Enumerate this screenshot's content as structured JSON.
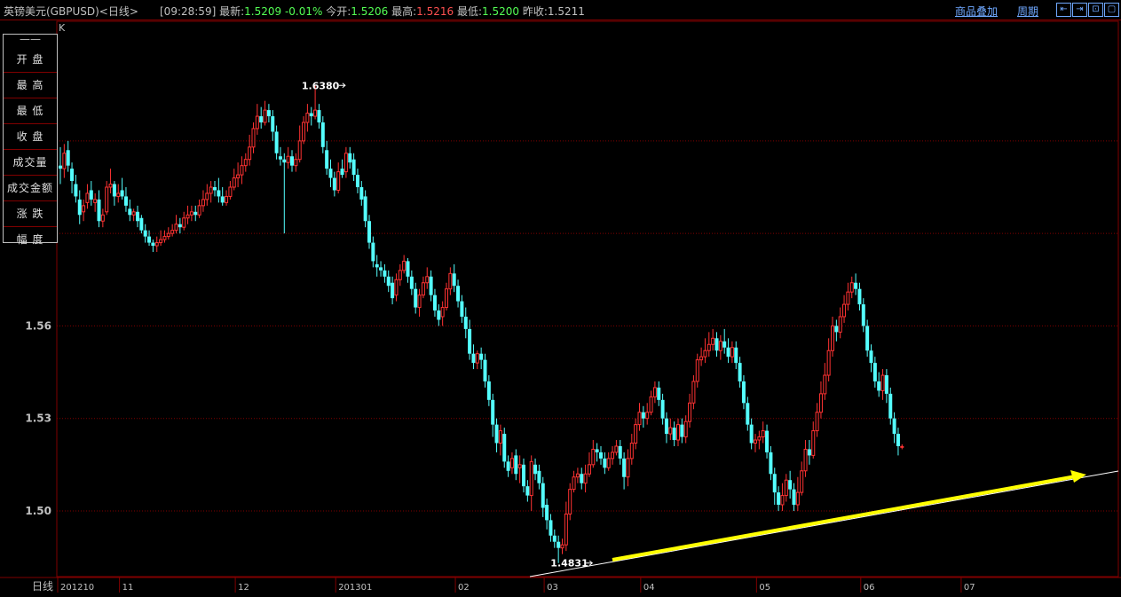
{
  "header": {
    "title": "英镑美元(GBPUSD)<日线>",
    "time": "[09:28:59]",
    "latest_label": "最新:",
    "latest_value": "1.5209",
    "change": "-0.01%",
    "open_label": "今开:",
    "open_value": "1.5206",
    "high_label": "最高:",
    "high_value": "1.5216",
    "low_label": "最低:",
    "low_value": "1.5200",
    "prev_close_label": "昨收:",
    "prev_close_value": "1.5211",
    "overlay_link": "商品叠加",
    "period_link": "周期"
  },
  "side_panel": {
    "items": [
      "开 盘",
      "最 高",
      "最 低",
      "收 盘",
      "成交量",
      "成交金额",
      "涨 跌",
      "幅 度"
    ]
  },
  "colors": {
    "up": "#ff3232",
    "down": "#54ffff",
    "grid": "#800000",
    "trend": "#ffff00"
  },
  "chart_data": {
    "type": "candlestick",
    "corner_label": "K",
    "period_label": "日线",
    "y_ticks": [
      {
        "value": 1.5,
        "label": "1.50"
      },
      {
        "value": 1.53,
        "label": "1.53"
      },
      {
        "value": 1.56,
        "label": "1.56"
      }
    ],
    "ylim": [
      1.4787,
      1.6588
    ],
    "x_ticks": [
      {
        "index": 0,
        "label": "201210"
      },
      {
        "index": 16,
        "label": "11"
      },
      {
        "index": 46,
        "label": "12"
      },
      {
        "index": 72,
        "label": "201301"
      },
      {
        "index": 103,
        "label": "02"
      },
      {
        "index": 126,
        "label": "03"
      },
      {
        "index": 151,
        "label": "04"
      },
      {
        "index": 181,
        "label": "05"
      },
      {
        "index": 208,
        "label": "06"
      },
      {
        "index": 234,
        "label": "07"
      }
    ],
    "max_annotation": {
      "index": 74,
      "value": 1.638,
      "label": "1.6380"
    },
    "min_annotation": {
      "index": 138,
      "value": 1.4831,
      "label": "1.4831"
    },
    "candles": [
      [
        1.612,
        1.611,
        1.618,
        1.606
      ],
      [
        1.611,
        1.616,
        1.619,
        1.608
      ],
      [
        1.617,
        1.612,
        1.62,
        1.61
      ],
      [
        1.611,
        1.607,
        1.613,
        1.603
      ],
      [
        1.606,
        1.602,
        1.609,
        1.6
      ],
      [
        1.601,
        1.596,
        1.604,
        1.593
      ],
      [
        1.597,
        1.599,
        1.601,
        1.594
      ],
      [
        1.6,
        1.603,
        1.606,
        1.598
      ],
      [
        1.604,
        1.601,
        1.607,
        1.599
      ],
      [
        1.6,
        1.601,
        1.603,
        1.597
      ],
      [
        1.601,
        1.594,
        1.604,
        1.592
      ],
      [
        1.594,
        1.596,
        1.598,
        1.592
      ],
      [
        1.597,
        1.605,
        1.607,
        1.596
      ],
      [
        1.605,
        1.606,
        1.611,
        1.603
      ],
      [
        1.606,
        1.602,
        1.607,
        1.599
      ],
      [
        1.602,
        1.603,
        1.606,
        1.6
      ],
      [
        1.604,
        1.602,
        1.608,
        1.601
      ],
      [
        1.602,
        1.599,
        1.605,
        1.597
      ],
      [
        1.598,
        1.596,
        1.601,
        1.594
      ],
      [
        1.596,
        1.597,
        1.598,
        1.594
      ],
      [
        1.597,
        1.594,
        1.599,
        1.592
      ],
      [
        1.595,
        1.591,
        1.596,
        1.59
      ],
      [
        1.591,
        1.589,
        1.593,
        1.587
      ],
      [
        1.589,
        1.587,
        1.591,
        1.586
      ],
      [
        1.587,
        1.586,
        1.588,
        1.584
      ],
      [
        1.586,
        1.587,
        1.589,
        1.584
      ],
      [
        1.587,
        1.588,
        1.591,
        1.586
      ],
      [
        1.588,
        1.589,
        1.591,
        1.587
      ],
      [
        1.589,
        1.59,
        1.592,
        1.588
      ],
      [
        1.59,
        1.591,
        1.593,
        1.589
      ],
      [
        1.591,
        1.593,
        1.596,
        1.59
      ],
      [
        1.593,
        1.592,
        1.595,
        1.59
      ],
      [
        1.592,
        1.595,
        1.597,
        1.591
      ],
      [
        1.595,
        1.596,
        1.599,
        1.593
      ],
      [
        1.596,
        1.597,
        1.599,
        1.594
      ],
      [
        1.597,
        1.596,
        1.599,
        1.594
      ],
      [
        1.596,
        1.599,
        1.601,
        1.595
      ],
      [
        1.599,
        1.601,
        1.604,
        1.597
      ],
      [
        1.601,
        1.603,
        1.606,
        1.599
      ],
      [
        1.603,
        1.605,
        1.607,
        1.6
      ],
      [
        1.605,
        1.604,
        1.607,
        1.602
      ],
      [
        1.604,
        1.602,
        1.608,
        1.6
      ],
      [
        1.602,
        1.6,
        1.605,
        1.599
      ],
      [
        1.6,
        1.602,
        1.604,
        1.599
      ],
      [
        1.602,
        1.605,
        1.607,
        1.601
      ],
      [
        1.605,
        1.608,
        1.611,
        1.604
      ],
      [
        1.608,
        1.609,
        1.613,
        1.605
      ],
      [
        1.609,
        1.612,
        1.615,
        1.606
      ],
      [
        1.612,
        1.614,
        1.616,
        1.61
      ],
      [
        1.614,
        1.618,
        1.622,
        1.612
      ],
      [
        1.618,
        1.624,
        1.626,
        1.616
      ],
      [
        1.624,
        1.628,
        1.632,
        1.622
      ],
      [
        1.628,
        1.626,
        1.631,
        1.624
      ],
      [
        1.626,
        1.63,
        1.633,
        1.625
      ],
      [
        1.63,
        1.628,
        1.632,
        1.626
      ],
      [
        1.628,
        1.623,
        1.63,
        1.62
      ],
      [
        1.623,
        1.616,
        1.625,
        1.614
      ],
      [
        1.615,
        1.614,
        1.618,
        1.612
      ],
      [
        1.614,
        1.613,
        1.616,
        1.59
      ],
      [
        1.613,
        1.615,
        1.618,
        1.611
      ],
      [
        1.615,
        1.612,
        1.617,
        1.61
      ],
      [
        1.612,
        1.614,
        1.616,
        1.61
      ],
      [
        1.614,
        1.62,
        1.625,
        1.613
      ],
      [
        1.62,
        1.626,
        1.628,
        1.619
      ],
      [
        1.626,
        1.629,
        1.632,
        1.623
      ],
      [
        1.629,
        1.628,
        1.631,
        1.625
      ],
      [
        1.628,
        1.63,
        1.638,
        1.627
      ],
      [
        1.63,
        1.626,
        1.632,
        1.624
      ],
      [
        1.626,
        1.618,
        1.628,
        1.616
      ],
      [
        1.617,
        1.611,
        1.62,
        1.609
      ],
      [
        1.611,
        1.608,
        1.614,
        1.605
      ],
      [
        1.608,
        1.604,
        1.61,
        1.602
      ],
      [
        1.604,
        1.61,
        1.613,
        1.603
      ],
      [
        1.611,
        1.609,
        1.614,
        1.608
      ],
      [
        1.61,
        1.616,
        1.618,
        1.608
      ],
      [
        1.616,
        1.613,
        1.618,
        1.611
      ],
      [
        1.614,
        1.609,
        1.616,
        1.607
      ],
      [
        1.609,
        1.605,
        1.611,
        1.603
      ],
      [
        1.605,
        1.601,
        1.607,
        1.599
      ],
      [
        1.602,
        1.594,
        1.604,
        1.592
      ],
      [
        1.594,
        1.587,
        1.596,
        1.585
      ],
      [
        1.587,
        1.581,
        1.589,
        1.579
      ],
      [
        1.58,
        1.579,
        1.583,
        1.576
      ],
      [
        1.579,
        1.578,
        1.581,
        1.576
      ],
      [
        1.578,
        1.576,
        1.58,
        1.574
      ],
      [
        1.576,
        1.573,
        1.578,
        1.571
      ],
      [
        1.574,
        1.569,
        1.576,
        1.567
      ],
      [
        1.57,
        1.575,
        1.577,
        1.568
      ],
      [
        1.575,
        1.578,
        1.58,
        1.573
      ],
      [
        1.578,
        1.581,
        1.583,
        1.577
      ],
      [
        1.581,
        1.576,
        1.582,
        1.574
      ],
      [
        1.576,
        1.572,
        1.578,
        1.57
      ],
      [
        1.572,
        1.566,
        1.574,
        1.564
      ],
      [
        1.566,
        1.57,
        1.572,
        1.563
      ],
      [
        1.57,
        1.574,
        1.576,
        1.569
      ],
      [
        1.574,
        1.576,
        1.579,
        1.572
      ],
      [
        1.576,
        1.57,
        1.578,
        1.568
      ],
      [
        1.57,
        1.565,
        1.572,
        1.563
      ],
      [
        1.565,
        1.562,
        1.567,
        1.56
      ],
      [
        1.563,
        1.566,
        1.568,
        1.56
      ],
      [
        1.566,
        1.572,
        1.574,
        1.565
      ],
      [
        1.572,
        1.577,
        1.579,
        1.57
      ],
      [
        1.577,
        1.573,
        1.58,
        1.571
      ],
      [
        1.573,
        1.568,
        1.575,
        1.566
      ],
      [
        1.568,
        1.563,
        1.57,
        1.561
      ],
      [
        1.563,
        1.559,
        1.566,
        1.556
      ],
      [
        1.559,
        1.551,
        1.562,
        1.549
      ],
      [
        1.551,
        1.548,
        1.554,
        1.546
      ],
      [
        1.548,
        1.551,
        1.552,
        1.546
      ],
      [
        1.551,
        1.549,
        1.553,
        1.546
      ],
      [
        1.549,
        1.542,
        1.551,
        1.54
      ],
      [
        1.542,
        1.536,
        1.544,
        1.534
      ],
      [
        1.536,
        1.528,
        1.538,
        1.524
      ],
      [
        1.528,
        1.522,
        1.53,
        1.519
      ],
      [
        1.522,
        1.526,
        1.528,
        1.518
      ],
      [
        1.525,
        1.516,
        1.527,
        1.514
      ],
      [
        1.516,
        1.513,
        1.518,
        1.511
      ],
      [
        1.514,
        1.517,
        1.519,
        1.512
      ],
      [
        1.518,
        1.512,
        1.52,
        1.51
      ],
      [
        1.514,
        1.515,
        1.518,
        1.509
      ],
      [
        1.515,
        1.508,
        1.517,
        1.506
      ],
      [
        1.508,
        1.505,
        1.51,
        1.503
      ],
      [
        1.505,
        1.516,
        1.518,
        1.5
      ],
      [
        1.515,
        1.512,
        1.517,
        1.51
      ],
      [
        1.513,
        1.509,
        1.515,
        1.507
      ],
      [
        1.509,
        1.501,
        1.511,
        1.498
      ],
      [
        1.502,
        1.497,
        1.504,
        1.494
      ],
      [
        1.497,
        1.492,
        1.499,
        1.49
      ],
      [
        1.492,
        1.49,
        1.494,
        1.488
      ],
      [
        1.49,
        1.488,
        1.492,
        1.4831
      ],
      [
        1.488,
        1.489,
        1.491,
        1.486
      ],
      [
        1.489,
        1.499,
        1.503,
        1.487
      ],
      [
        1.499,
        1.507,
        1.509,
        1.497
      ],
      [
        1.507,
        1.511,
        1.513,
        1.506
      ],
      [
        1.511,
        1.512,
        1.514,
        1.509
      ],
      [
        1.512,
        1.509,
        1.514,
        1.507
      ],
      [
        1.509,
        1.512,
        1.515,
        1.506
      ],
      [
        1.512,
        1.515,
        1.519,
        1.511
      ],
      [
        1.515,
        1.52,
        1.523,
        1.514
      ],
      [
        1.52,
        1.519,
        1.522,
        1.516
      ],
      [
        1.519,
        1.517,
        1.521,
        1.515
      ],
      [
        1.517,
        1.514,
        1.519,
        1.512
      ],
      [
        1.514,
        1.517,
        1.519,
        1.513
      ],
      [
        1.517,
        1.519,
        1.521,
        1.515
      ],
      [
        1.519,
        1.521,
        1.523,
        1.518
      ],
      [
        1.521,
        1.517,
        1.523,
        1.515
      ],
      [
        1.517,
        1.511,
        1.519,
        1.507
      ],
      [
        1.511,
        1.517,
        1.52,
        1.508
      ],
      [
        1.517,
        1.522,
        1.525,
        1.515
      ],
      [
        1.522,
        1.528,
        1.53,
        1.52
      ],
      [
        1.528,
        1.532,
        1.535,
        1.526
      ],
      [
        1.532,
        1.53,
        1.534,
        1.527
      ],
      [
        1.53,
        1.532,
        1.535,
        1.528
      ],
      [
        1.532,
        1.537,
        1.539,
        1.531
      ],
      [
        1.537,
        1.54,
        1.542,
        1.535
      ],
      [
        1.54,
        1.536,
        1.542,
        1.534
      ],
      [
        1.536,
        1.53,
        1.538,
        1.528
      ],
      [
        1.53,
        1.525,
        1.532,
        1.522
      ],
      [
        1.525,
        1.527,
        1.53,
        1.523
      ],
      [
        1.527,
        1.523,
        1.529,
        1.521
      ],
      [
        1.523,
        1.528,
        1.53,
        1.521
      ],
      [
        1.528,
        1.524,
        1.53,
        1.522
      ],
      [
        1.524,
        1.529,
        1.531,
        1.522
      ],
      [
        1.529,
        1.535,
        1.538,
        1.527
      ],
      [
        1.535,
        1.542,
        1.544,
        1.533
      ],
      [
        1.542,
        1.549,
        1.551,
        1.54
      ],
      [
        1.549,
        1.55,
        1.553,
        1.547
      ],
      [
        1.55,
        1.552,
        1.556,
        1.548
      ],
      [
        1.552,
        1.554,
        1.558,
        1.55
      ],
      [
        1.554,
        1.556,
        1.559,
        1.552
      ],
      [
        1.556,
        1.552,
        1.558,
        1.55
      ],
      [
        1.552,
        1.555,
        1.557,
        1.549
      ],
      [
        1.555,
        1.553,
        1.559,
        1.551
      ],
      [
        1.553,
        1.55,
        1.556,
        1.548
      ],
      [
        1.55,
        1.553,
        1.555,
        1.548
      ],
      [
        1.553,
        1.548,
        1.555,
        1.546
      ],
      [
        1.548,
        1.542,
        1.55,
        1.54
      ],
      [
        1.542,
        1.535,
        1.544,
        1.533
      ],
      [
        1.535,
        1.528,
        1.537,
        1.526
      ],
      [
        1.528,
        1.522,
        1.53,
        1.52
      ],
      [
        1.522,
        1.523,
        1.525,
        1.519
      ],
      [
        1.523,
        1.524,
        1.526,
        1.52
      ],
      [
        1.524,
        1.526,
        1.529,
        1.522
      ],
      [
        1.526,
        1.519,
        1.528,
        1.517
      ],
      [
        1.519,
        1.512,
        1.521,
        1.51
      ],
      [
        1.512,
        1.506,
        1.514,
        1.502
      ],
      [
        1.506,
        1.502,
        1.508,
        1.5
      ],
      [
        1.502,
        1.505,
        1.509,
        1.5
      ],
      [
        1.505,
        1.51,
        1.512,
        1.503
      ],
      [
        1.51,
        1.507,
        1.513,
        1.504
      ],
      [
        1.507,
        1.502,
        1.509,
        1.5
      ],
      [
        1.502,
        1.506,
        1.511,
        1.5
      ],
      [
        1.506,
        1.513,
        1.516,
        1.505
      ],
      [
        1.513,
        1.52,
        1.523,
        1.511
      ],
      [
        1.52,
        1.518,
        1.523,
        1.515
      ],
      [
        1.518,
        1.526,
        1.529,
        1.517
      ],
      [
        1.526,
        1.532,
        1.535,
        1.524
      ],
      [
        1.532,
        1.538,
        1.542,
        1.53
      ],
      [
        1.538,
        1.544,
        1.548,
        1.536
      ],
      [
        1.544,
        1.552,
        1.556,
        1.542
      ],
      [
        1.552,
        1.56,
        1.563,
        1.55
      ],
      [
        1.56,
        1.558,
        1.562,
        1.555
      ],
      [
        1.558,
        1.563,
        1.566,
        1.556
      ],
      [
        1.563,
        1.567,
        1.57,
        1.561
      ],
      [
        1.567,
        1.571,
        1.574,
        1.565
      ],
      [
        1.571,
        1.574,
        1.576,
        1.569
      ],
      [
        1.574,
        1.572,
        1.577,
        1.57
      ],
      [
        1.572,
        1.567,
        1.574,
        1.565
      ],
      [
        1.567,
        1.56,
        1.569,
        1.558
      ],
      [
        1.56,
        1.552,
        1.562,
        1.55
      ],
      [
        1.552,
        1.548,
        1.554,
        1.545
      ],
      [
        1.548,
        1.542,
        1.55,
        1.54
      ],
      [
        1.542,
        1.539,
        1.545,
        1.537
      ],
      [
        1.539,
        1.544,
        1.546,
        1.536
      ],
      [
        1.544,
        1.538,
        1.546,
        1.535
      ],
      [
        1.538,
        1.53,
        1.54,
        1.528
      ],
      [
        1.53,
        1.525,
        1.532,
        1.522
      ],
      [
        1.525,
        1.521,
        1.527,
        1.518
      ],
      [
        1.5209,
        1.5209,
        1.5216,
        1.52
      ]
    ]
  }
}
